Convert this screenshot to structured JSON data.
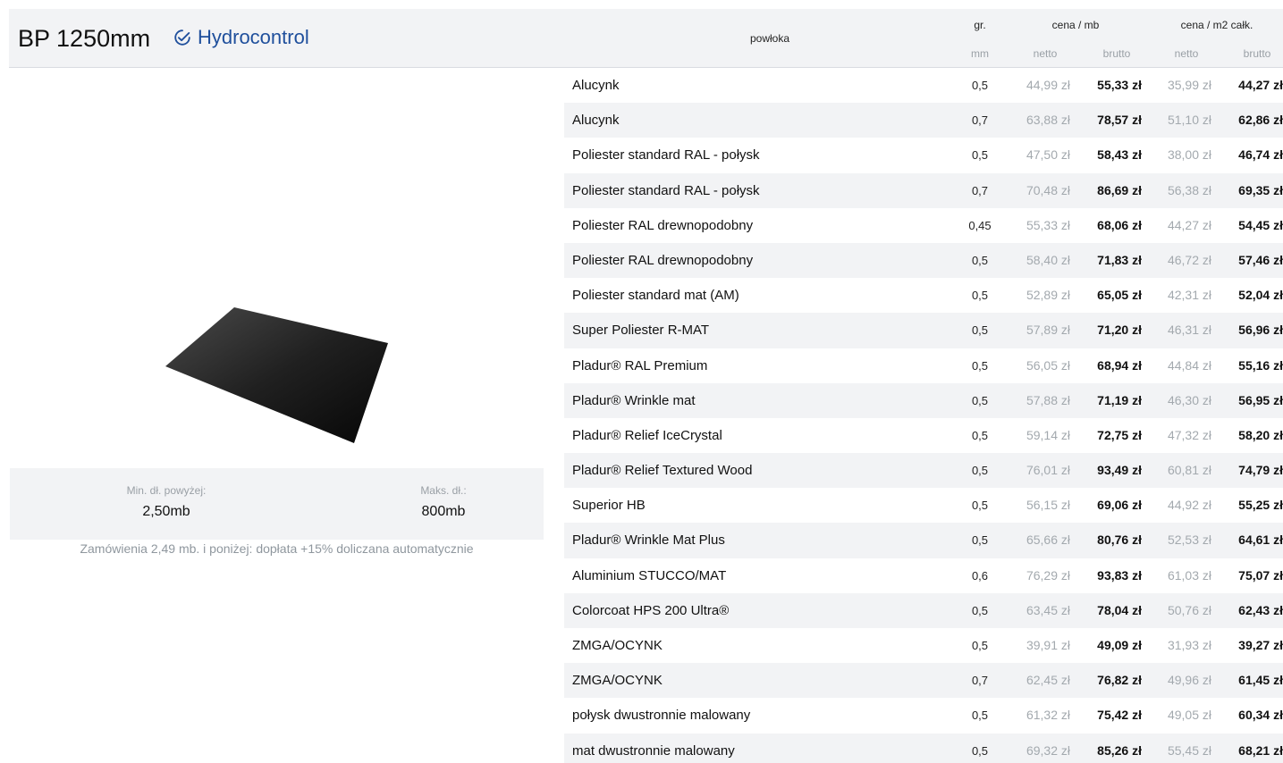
{
  "product": {
    "title": "BP 1250mm",
    "badge": "Hydrocontrol",
    "badge_icon": "check-circle-icon",
    "badge_color": "#1f4f9c"
  },
  "lengths": {
    "min_label": "Min. dł. powyżej:",
    "min_value": "2,50mb",
    "max_label": "Maks. dł.:",
    "max_value": "800mb",
    "note": "Zamówienia 2,49 mb. i poniżej: dopłata +15% doliczana automatycznie"
  },
  "table": {
    "headers": {
      "coating": "powłoka",
      "thickness": "gr.",
      "thickness_unit": "mm",
      "price_mb": "cena / mb",
      "price_m2": "cena / m2 całk.",
      "net": "netto",
      "gross": "brutto"
    },
    "rows": [
      {
        "name": "Alucynk",
        "mm": "0,5",
        "net_mb": "44,99 zł",
        "gross_mb": "55,33 zł",
        "net_m2": "35,99 zł",
        "gross_m2": "44,27 zł"
      },
      {
        "name": "Alucynk",
        "mm": "0,7",
        "net_mb": "63,88 zł",
        "gross_mb": "78,57 zł",
        "net_m2": "51,10 zł",
        "gross_m2": "62,86 zł"
      },
      {
        "name": "Poliester standard RAL - połysk",
        "mm": "0,5",
        "net_mb": "47,50 zł",
        "gross_mb": "58,43 zł",
        "net_m2": "38,00 zł",
        "gross_m2": "46,74 zł"
      },
      {
        "name": "Poliester standard RAL - połysk",
        "mm": "0,7",
        "net_mb": "70,48 zł",
        "gross_mb": "86,69 zł",
        "net_m2": "56,38 zł",
        "gross_m2": "69,35 zł"
      },
      {
        "name": "Poliester RAL drewnopodobny",
        "mm": "0,45",
        "net_mb": "55,33 zł",
        "gross_mb": "68,06 zł",
        "net_m2": "44,27 zł",
        "gross_m2": "54,45 zł"
      },
      {
        "name": "Poliester RAL drewnopodobny",
        "mm": "0,5",
        "net_mb": "58,40 zł",
        "gross_mb": "71,83 zł",
        "net_m2": "46,72 zł",
        "gross_m2": "57,46 zł"
      },
      {
        "name": "Poliester standard mat (AM)",
        "mm": "0,5",
        "net_mb": "52,89 zł",
        "gross_mb": "65,05 zł",
        "net_m2": "42,31 zł",
        "gross_m2": "52,04 zł"
      },
      {
        "name": "Super Poliester R-MAT",
        "mm": "0,5",
        "net_mb": "57,89 zł",
        "gross_mb": "71,20 zł",
        "net_m2": "46,31 zł",
        "gross_m2": "56,96 zł"
      },
      {
        "name": "Pladur® RAL Premium",
        "mm": "0,5",
        "net_mb": "56,05 zł",
        "gross_mb": "68,94 zł",
        "net_m2": "44,84 zł",
        "gross_m2": "55,16 zł"
      },
      {
        "name": "Pladur® Wrinkle mat",
        "mm": "0,5",
        "net_mb": "57,88 zł",
        "gross_mb": "71,19 zł",
        "net_m2": "46,30 zł",
        "gross_m2": "56,95 zł"
      },
      {
        "name": "Pladur® Relief IceCrystal",
        "mm": "0,5",
        "net_mb": "59,14 zł",
        "gross_mb": "72,75 zł",
        "net_m2": "47,32 zł",
        "gross_m2": "58,20 zł"
      },
      {
        "name": "Pladur® Relief Textured Wood",
        "mm": "0,5",
        "net_mb": "76,01 zł",
        "gross_mb": "93,49 zł",
        "net_m2": "60,81 zł",
        "gross_m2": "74,79 zł"
      },
      {
        "name": "Superior HB",
        "mm": "0,5",
        "net_mb": "56,15 zł",
        "gross_mb": "69,06 zł",
        "net_m2": "44,92 zł",
        "gross_m2": "55,25 zł"
      },
      {
        "name": "Pladur® Wrinkle Mat Plus",
        "mm": "0,5",
        "net_mb": "65,66 zł",
        "gross_mb": "80,76 zł",
        "net_m2": "52,53 zł",
        "gross_m2": "64,61 zł"
      },
      {
        "name": "Aluminium STUCCO/MAT",
        "mm": "0,6",
        "net_mb": "76,29 zł",
        "gross_mb": "93,83 zł",
        "net_m2": "61,03 zł",
        "gross_m2": "75,07 zł"
      },
      {
        "name": "Colorcoat HPS 200 Ultra®",
        "mm": "0,5",
        "net_mb": "63,45 zł",
        "gross_mb": "78,04 zł",
        "net_m2": "50,76 zł",
        "gross_m2": "62,43 zł"
      },
      {
        "name": "ZMGA/OCYNK",
        "mm": "0,5",
        "net_mb": "39,91 zł",
        "gross_mb": "49,09 zł",
        "net_m2": "31,93 zł",
        "gross_m2": "39,27 zł"
      },
      {
        "name": "ZMGA/OCYNK",
        "mm": "0,7",
        "net_mb": "62,45 zł",
        "gross_mb": "76,82 zł",
        "net_m2": "49,96 zł",
        "gross_m2": "61,45 zł"
      },
      {
        "name": "połysk dwustronnie malowany",
        "mm": "0,5",
        "net_mb": "61,32 zł",
        "gross_mb": "75,42 zł",
        "net_m2": "49,05 zł",
        "gross_m2": "60,34 zł"
      },
      {
        "name": "mat dwustronnie malowany",
        "mm": "0,5",
        "net_mb": "69,32 zł",
        "gross_mb": "85,26 zł",
        "net_m2": "55,45 zł",
        "gross_m2": "68,21 zł"
      }
    ]
  }
}
